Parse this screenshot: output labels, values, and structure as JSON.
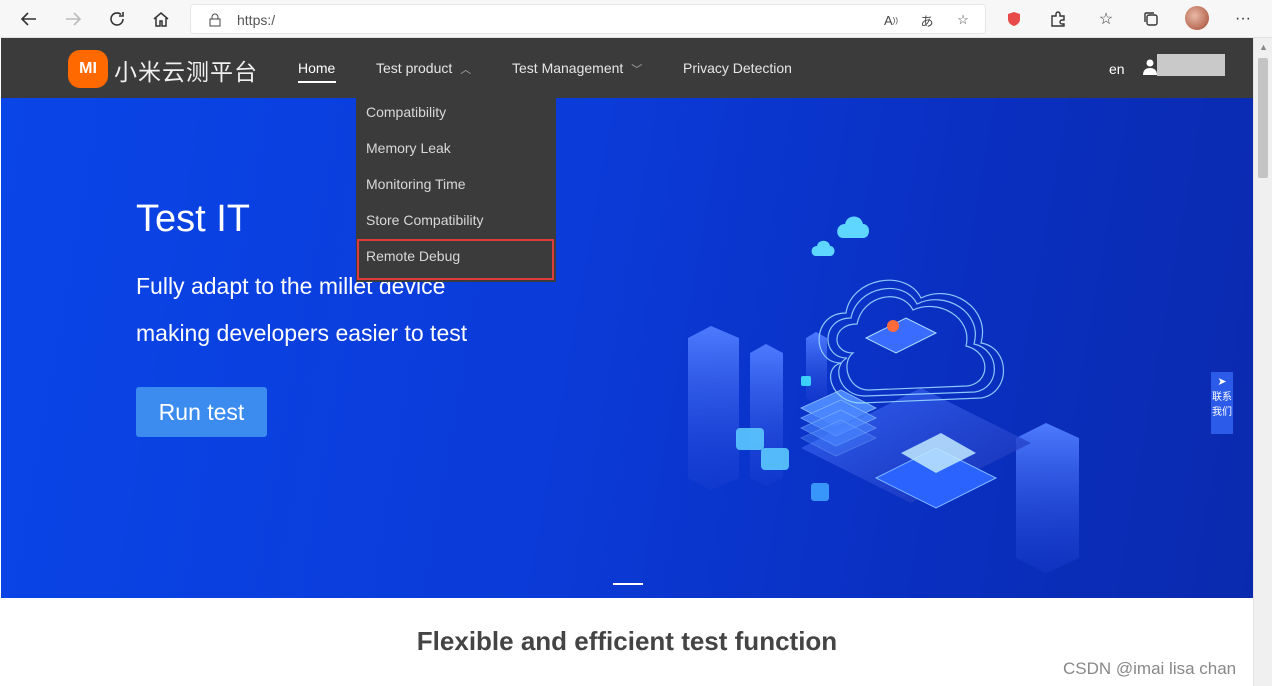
{
  "browser": {
    "url": "https:/",
    "icons": [
      "back-icon",
      "forward-icon",
      "refresh-icon",
      "home-icon",
      "lock-icon",
      "read-aloud-icon",
      "translate-icon",
      "add-favorite-icon",
      "shield-extension-icon",
      "extensions-icon",
      "favorites-icon",
      "collections-icon",
      "profile-avatar",
      "more-icon"
    ]
  },
  "header": {
    "logo_mark": "MI",
    "logo_text": "小米云测平台",
    "nav": {
      "home": "Home",
      "test_product": "Test product",
      "test_management": "Test Management",
      "privacy_detection": "Privacy Detection"
    },
    "lang": "en"
  },
  "dropdown": {
    "items": [
      "Compatibility",
      "Memory Leak",
      "Monitoring Time",
      "Store Compatibility",
      "Remote Debug"
    ]
  },
  "hero": {
    "title": "Test IT",
    "subtitle_line1": "Fully adapt to the millet device",
    "subtitle_line2": "making developers easier to test",
    "cta": "Run test"
  },
  "contact": {
    "line1": "联系",
    "line2": "我们"
  },
  "section": {
    "title": "Flexible and efficient test function"
  },
  "watermark": "CSDN @imai lisa chan",
  "colors": {
    "brand": "#ff6900",
    "header_bg": "#3b3b3b",
    "hero_blue": "#0b3bd8",
    "cta": "#3c8cf0",
    "highlight": "#e03b3b"
  }
}
